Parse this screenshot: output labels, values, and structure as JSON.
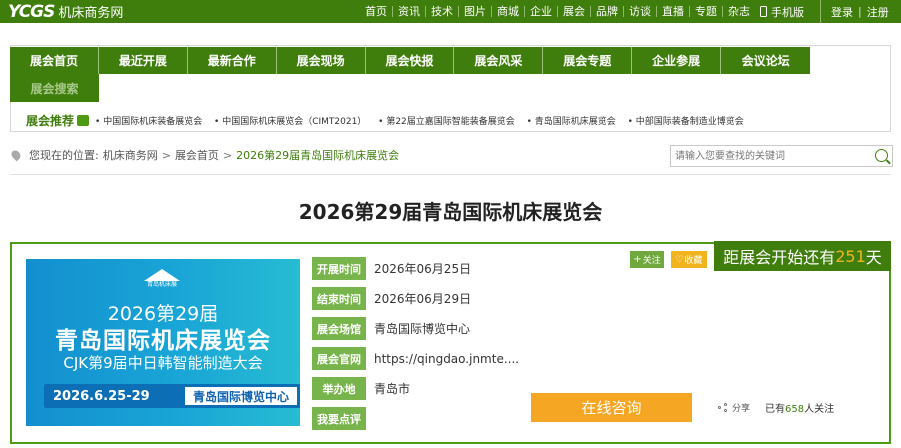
{
  "header": {
    "logo_mark": "YCGS",
    "logo_text": "机床商务网",
    "nav": [
      "首页",
      "资讯",
      "技术",
      "图片",
      "商城",
      "企业",
      "展会",
      "品牌",
      "访谈",
      "直播",
      "专题",
      "杂志"
    ],
    "mobile": "手机版",
    "login": "登录",
    "register": "注册",
    "auth_sep": "|"
  },
  "mainnav": {
    "items": [
      "展会首页",
      "最近开展",
      "最新合作",
      "展会现场",
      "展会快报",
      "展会风采",
      "展会专题",
      "企业参展",
      "会议论坛"
    ],
    "row2": "展会搜索"
  },
  "recommend": {
    "label": "展会推荐",
    "items": [
      "中国国际机床装备展览会",
      "中国国际机床展览会（CIMT2021）",
      "第22届立嘉国际智能装备展览会",
      "青岛国际机床展览会",
      "中部国际装备制造业博览会"
    ]
  },
  "breadcrumb": {
    "prefix": "您现在的位置:",
    "items": [
      "机床商务网",
      "展会首页"
    ],
    "arrow": ">",
    "current": "2026第29届青岛国际机床展览会"
  },
  "search": {
    "placeholder": "请输入您要查找的关键词"
  },
  "page_title": "2026第29届青岛国际机床展览会",
  "poster": {
    "emblem_text": "青岛机床展",
    "line1": "2026第29届",
    "line2": "青岛国际机床展览会",
    "line3": "CJK第9届中日韩智能制造大会",
    "date": "2026.6.25-29",
    "venue": "青岛国际博览中心"
  },
  "info": [
    {
      "label": "开展时间",
      "value": "2026年06月25日"
    },
    {
      "label": "结束时间",
      "value": "2026年06月29日"
    },
    {
      "label": "展会场馆",
      "value": "青岛国际博览中心"
    },
    {
      "label": "展会官网",
      "value": "https://qingdao.jnmte...."
    },
    {
      "label": "举办地",
      "value": "青岛市"
    },
    {
      "label": "我要点评",
      "value": ""
    }
  ],
  "actions": {
    "follow": "关注",
    "favorite": "收藏",
    "consult": "在线咨询",
    "share": "分享"
  },
  "countdown": {
    "prefix": "距展会开始还有",
    "days": "251",
    "suffix": "天"
  },
  "followers": {
    "prefix": "已有",
    "count": "658",
    "suffix": "人关注"
  },
  "colors": {
    "brand_green": "#3f7d0c",
    "label_green": "#78b44c",
    "accent_orange": "#f5a623",
    "highlight_yellow": "#f3b51e"
  }
}
